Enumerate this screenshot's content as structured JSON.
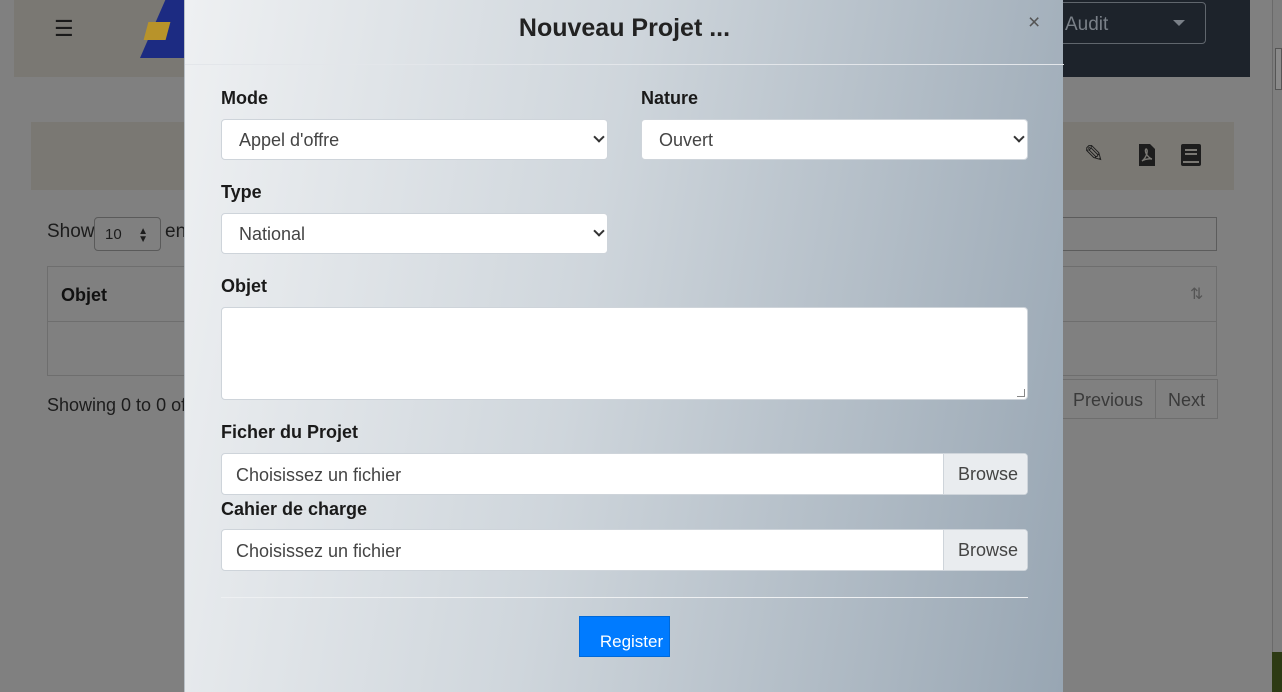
{
  "background": {
    "header": {
      "menu_icon": "hamburger-icon",
      "audit_label": "Audit"
    },
    "toolbar": {
      "icons": [
        "pencil-icon",
        "pdf-icon",
        "book-icon"
      ]
    },
    "table_controls": {
      "show_label": "Show",
      "page_size": "10",
      "entries_label": "en"
    },
    "table": {
      "columns": [
        "Objet"
      ],
      "sort_icon": "sort-icon"
    },
    "info": "Showing 0 to 0 of",
    "pagination": {
      "previous": "Previous",
      "next": "Next"
    }
  },
  "modal": {
    "title": "Nouveau Projet ...",
    "close_label": "×",
    "mode": {
      "label": "Mode",
      "value": "Appel d'offre"
    },
    "nature": {
      "label": "Nature",
      "value": "Ouvert"
    },
    "type": {
      "label": "Type",
      "value": "National"
    },
    "objet": {
      "label": "Objet",
      "value": ""
    },
    "fichier_projet": {
      "label": "Ficher du Projet",
      "placeholder": "Choisissez un fichier",
      "button": "Browse"
    },
    "cahier_charge": {
      "label": "Cahier de charge",
      "placeholder": "Choisissez un fichier",
      "button": "Browse"
    },
    "submit": "Register"
  },
  "colors": {
    "primary": "#007bff",
    "backdrop": "#808080",
    "header_dark": "#1d232b"
  }
}
